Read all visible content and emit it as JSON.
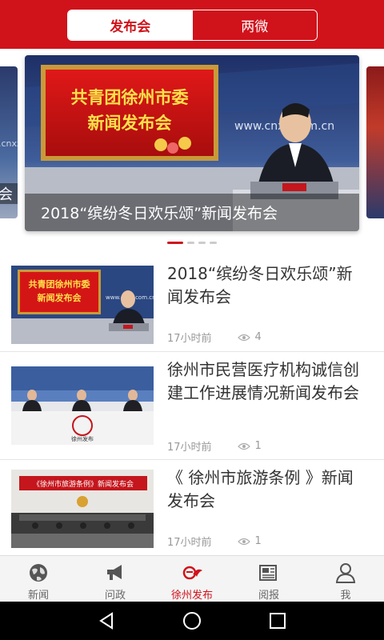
{
  "header": {
    "tabs": [
      {
        "label": "发布会",
        "active": true
      },
      {
        "label": "两微",
        "active": false
      }
    ],
    "color": "#d0121b"
  },
  "carousel": {
    "left_caption": "会",
    "main_caption": "2018“缤纷冬日欢乐颂”新闻发布会",
    "banner_line1": "共青团徐州市委",
    "banner_line2": "新闻发布会",
    "watermark": "www.cnxz.com.cn",
    "left_watermark": ".cnxz.com.cn",
    "dots": 4,
    "active_dot": 0
  },
  "news": [
    {
      "title": "2018“缤纷冬日欢乐颂”新闻发布会",
      "time": "17小时前",
      "views": "4",
      "thumb_line1": "共青团徐州市委",
      "thumb_line2": "新闻发布会",
      "thumb_watermark": "www.cnxz.com.cn"
    },
    {
      "title": "徐州市民营医疗机构诚信创建工作进展情况新闻发布会",
      "time": "17小时前",
      "views": "1",
      "thumb_logo": "徐州发布"
    },
    {
      "title": "《 徐州市旅游条例 》新闻发布会",
      "time": "17小时前",
      "views": "1",
      "thumb_banner": "《徐州市旅游条例》新闻发布会"
    }
  ],
  "tabbar": [
    {
      "label": "新闻",
      "icon": "globe-icon",
      "active": false
    },
    {
      "label": "问政",
      "icon": "megaphone-icon",
      "active": false
    },
    {
      "label": "徐州发布",
      "icon": "xuzhou-logo-icon",
      "active": true
    },
    {
      "label": "阅报",
      "icon": "newspaper-icon",
      "active": false
    },
    {
      "label": "我",
      "icon": "person-icon",
      "active": false
    }
  ],
  "system_nav": [
    "back-icon",
    "home-icon",
    "recents-icon"
  ]
}
